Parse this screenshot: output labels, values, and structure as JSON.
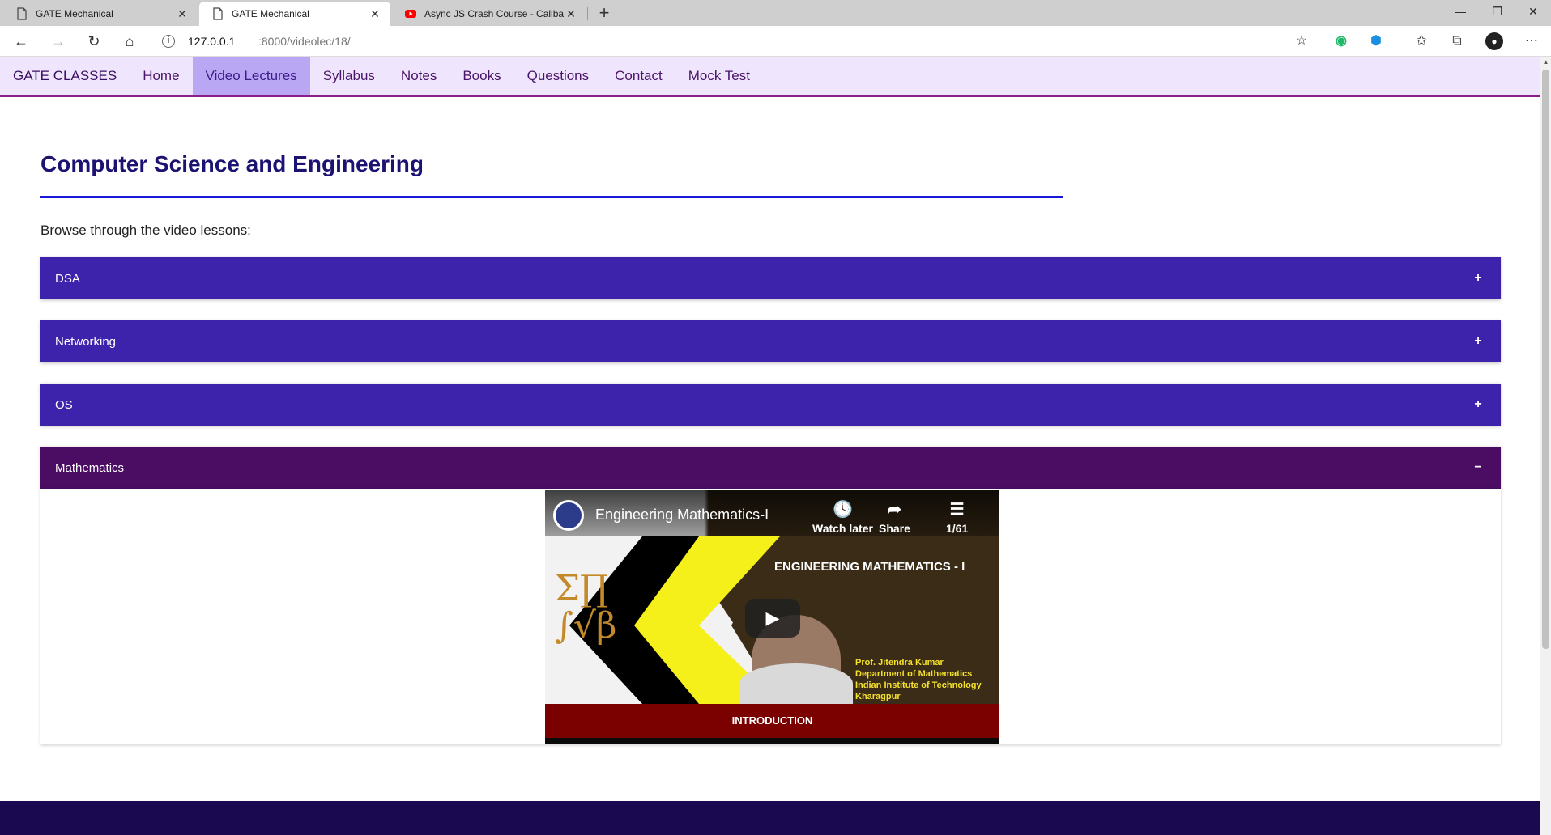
{
  "browser": {
    "tabs": [
      {
        "title": "GATE Mechanical",
        "active": false
      },
      {
        "title": "GATE Mechanical",
        "active": true
      },
      {
        "title": "Async JS Crash Course - Callback",
        "active": false
      }
    ],
    "address": {
      "host": "127.0.0.1",
      "path": ":8000/videolec/18/"
    },
    "youtube_red": "#ff0000"
  },
  "site": {
    "brand": "GATE CLASSES",
    "nav": [
      "Home",
      "Video Lectures",
      "Syllabus",
      "Notes",
      "Books",
      "Questions",
      "Contact",
      "Mock Test"
    ],
    "active_nav": "Video Lectures"
  },
  "main": {
    "title": "Computer Science and Engineering",
    "intro": "Browse through the video lessons:",
    "accordion": [
      {
        "label": "DSA",
        "toggle": "+",
        "open": false
      },
      {
        "label": "Networking",
        "toggle": "+",
        "open": false
      },
      {
        "label": "OS",
        "toggle": "+",
        "open": false
      },
      {
        "label": "Mathematics",
        "toggle": "−",
        "open": true
      }
    ]
  },
  "video": {
    "title": "Engineering Mathematics-I",
    "watch_later": "Watch later",
    "share": "Share",
    "playlist_count": "1/61",
    "heading": "ENGINEERING MATHEMATICS - I",
    "credit": [
      "Prof. Jitendra Kumar",
      "Department of Mathematics",
      "Indian Institute of Technology",
      "Kharagpur"
    ],
    "bottom_label": "INTRODUCTION"
  },
  "colors": {
    "accordion_closed": "#3d22ab",
    "accordion_open": "#4b0c63",
    "title": "#1c1272",
    "footer": "#1a0851"
  }
}
